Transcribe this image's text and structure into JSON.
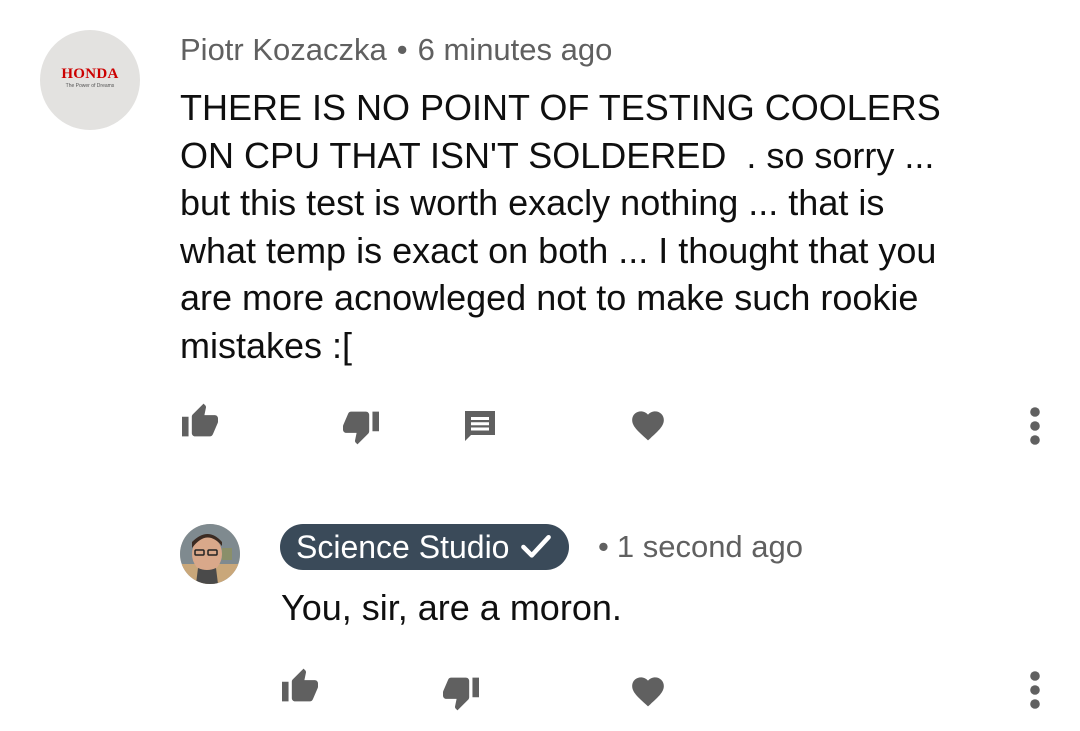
{
  "comment": {
    "author": "Piotr Kozaczka",
    "time": "6 minutes ago",
    "text": "THERE IS NO POINT OF TESTING COOLERS\nON CPU THAT ISN'T SOLDERED  . so sorry ...\nbut this test is worth exacly nothing ... that is\nwhat temp is exact on both ... I thought that you\nare more acnowleged not to make such rookie\nmistakes :[",
    "avatar": {
      "brand": "HONDA",
      "tagline": "The Power of Dreams"
    }
  },
  "reply": {
    "author": "Science Studio",
    "verified_icon": "check-icon",
    "time": "1 second ago",
    "text": "You, sir, are a moron."
  },
  "separator": "•",
  "icons": {
    "like": "thumbs-up-icon",
    "dislike": "thumbs-down-icon",
    "reply": "comment-icon",
    "heart": "heart-icon",
    "menu": "more-vertical-icon"
  },
  "colors": {
    "icon": "#606060",
    "chip_background": "#3a4a59",
    "honda_red": "#cc0000",
    "text": "#0f0f0f",
    "meta": "#606060"
  }
}
